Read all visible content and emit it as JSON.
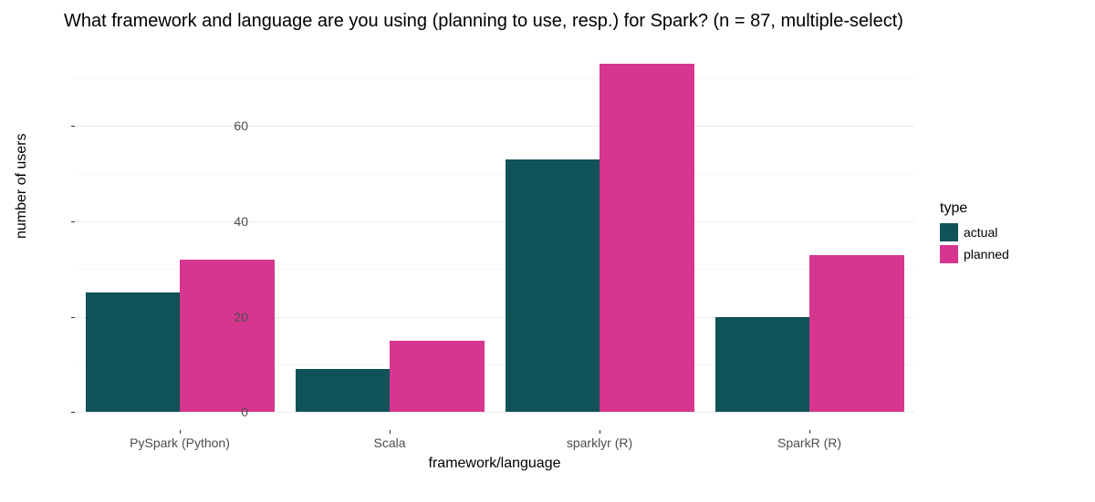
{
  "chart_data": {
    "type": "bar",
    "title": "What framework and language are you using (planning to use, resp.) for Spark? (n = 87, multiple-select)",
    "xlabel": "framework/language",
    "ylabel": "number of users",
    "categories": [
      "PySpark (Python)",
      "Scala",
      "sparklyr (R)",
      "SparkR (R)"
    ],
    "series": [
      {
        "name": "actual",
        "values": [
          25,
          9,
          53,
          20
        ],
        "color": "#0f5257"
      },
      {
        "name": "planned",
        "values": [
          32,
          15,
          73,
          33
        ],
        "color": "#d6368f"
      }
    ],
    "y_ticks": [
      0,
      20,
      40,
      60
    ],
    "ylim": [
      -3.8,
      76.5
    ],
    "legend_title": "type"
  }
}
